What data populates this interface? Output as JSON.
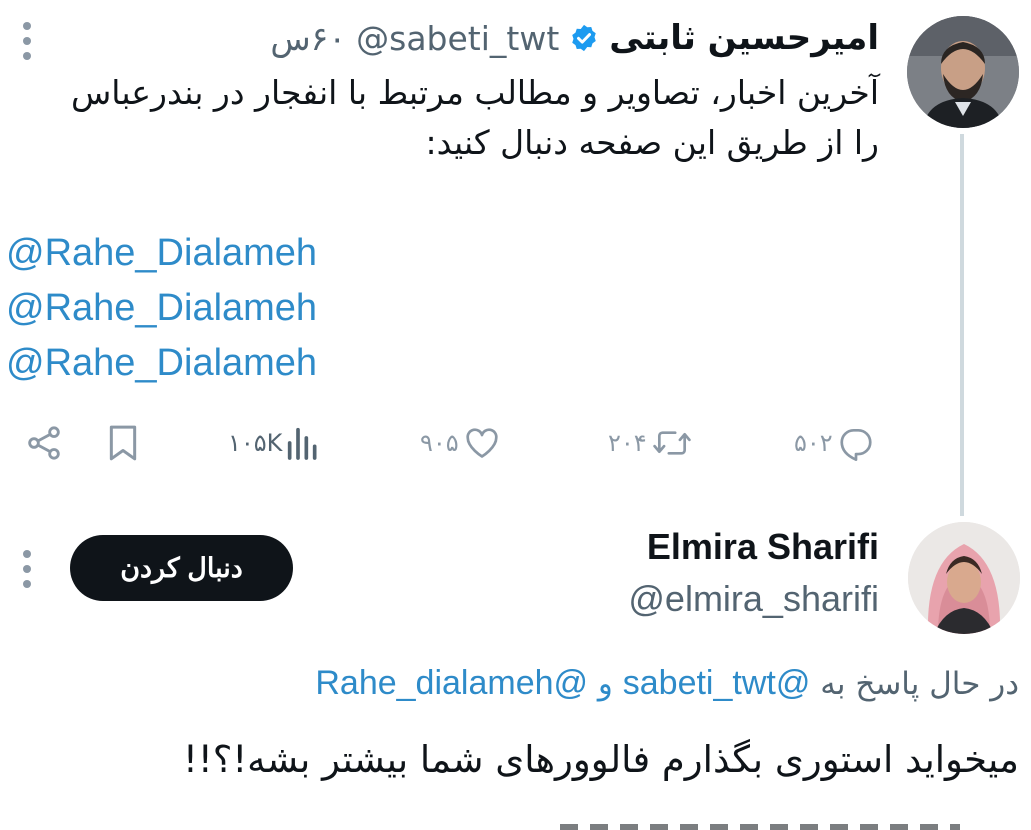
{
  "tweet1": {
    "author_name": "امیرحسین ثابتی",
    "author_handle": "@sabeti_twt",
    "time": "۶۰س",
    "verified": true,
    "body_line1": "آخرین اخبار، تصاویر و مطالب مرتبط با انفجار در بندرعباس",
    "body_line2": "را از طریق این صفحه دنبال کنید:",
    "mentions": [
      "@Rahe_Dialameh",
      "@Rahe_Dialameh",
      "@Rahe_Dialameh"
    ],
    "stats": {
      "replies": "۵۰۲",
      "retweets": "۲۰۴",
      "likes": "۹۰۵",
      "views": "۱۰۵K"
    }
  },
  "tweet2": {
    "author_name": "Elmira Sharifi",
    "author_handle": "@elmira_sharifi",
    "follow_label": "دنبال کردن",
    "replying_prefix": "در حال پاسخ به",
    "replying_mention1": "@sabeti_twt",
    "replying_and": "و",
    "replying_mention2": "@Rahe_dialameh",
    "body": "میخواید استوری بگذارم فالوورهای شما بیشتر بشه!؟!!"
  },
  "colors": {
    "accent": "#1d9bf0",
    "mention": "#2e8bc9",
    "muted": "#536471",
    "text": "#0f1419",
    "thread_line": "#cfd9de"
  },
  "icons": [
    "verified-badge-icon",
    "reply-icon",
    "retweet-icon",
    "like-icon",
    "views-icon",
    "bookmark-icon",
    "share-icon",
    "more-icon"
  ]
}
